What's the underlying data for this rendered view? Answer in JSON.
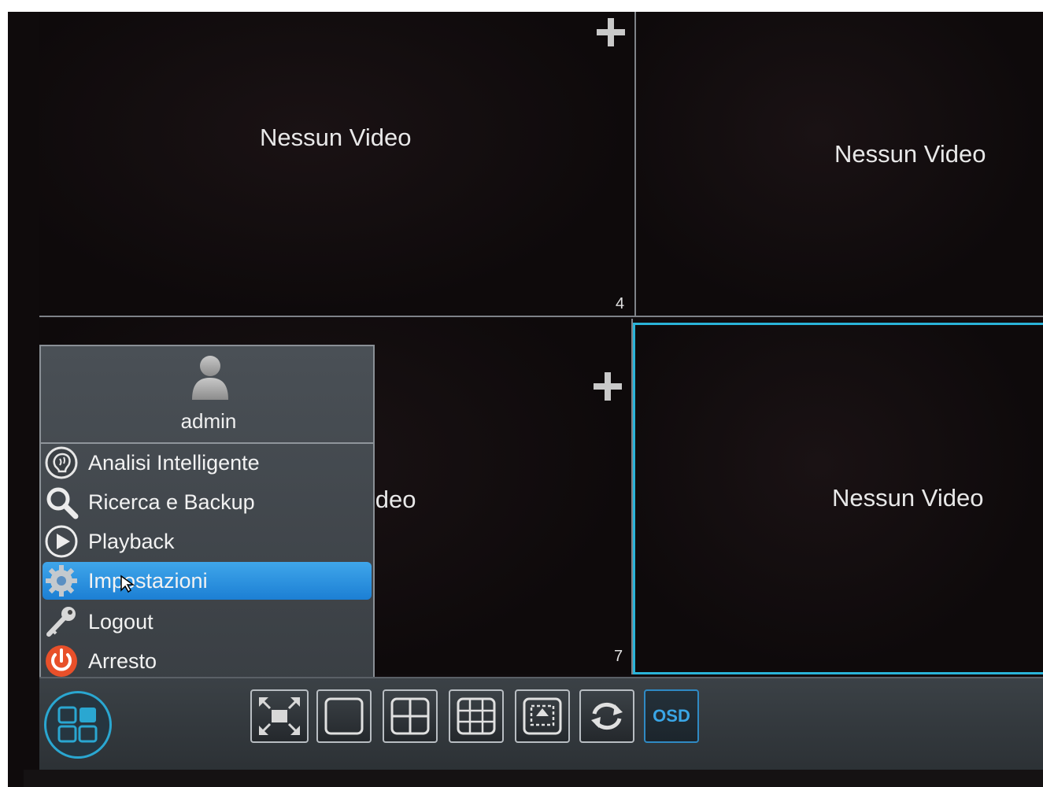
{
  "cells": [
    {
      "label": "Nessun Video",
      "number": ""
    },
    {
      "label": "Nessun Video",
      "number": ""
    },
    {
      "label": "Nessun Video",
      "number": "7"
    },
    {
      "label": "Nessun Video",
      "number": ""
    }
  ],
  "cell1_number": "4",
  "menu": {
    "username": "admin",
    "items": [
      {
        "label": "Analisi Intelligente",
        "icon": "brain-analysis-icon"
      },
      {
        "label": "Ricerca e Backup",
        "icon": "search-icon"
      },
      {
        "label": "Playback",
        "icon": "play-icon"
      },
      {
        "label": "Impostazioni",
        "icon": "gear-icon",
        "selected": true
      },
      {
        "label": "Logout",
        "icon": "key-icon"
      },
      {
        "label": "Arresto",
        "icon": "power-icon"
      }
    ]
  },
  "toolbar": {
    "osd_label": "OSD",
    "buttons": [
      "fullscreen-icon",
      "single-view-icon",
      "quad-view-icon",
      "nine-view-icon",
      "pip-icon",
      "sequence-icon"
    ]
  },
  "colors": {
    "selection_accent": "#2a8ee0",
    "active_cell_border": "#2ab3d8",
    "power_icon": "#e8502a"
  }
}
